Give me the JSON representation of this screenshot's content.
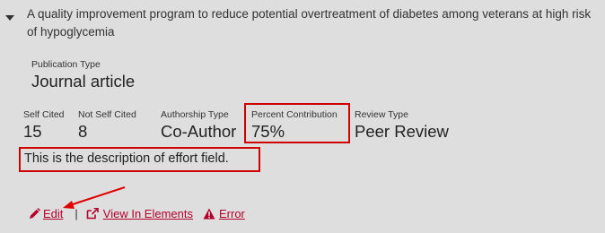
{
  "record": {
    "title": "A quality improvement program to reduce potential overtreatment of diabetes among veterans at high risk of hypoglycemia",
    "publication_type_label": "Publication Type",
    "publication_type_value": "Journal article"
  },
  "metrics": {
    "self_cited_label": "Self Cited",
    "self_cited_value": "15",
    "not_self_cited_label": "Not Self Cited",
    "not_self_cited_value": "8",
    "authorship_type_label": "Authorship Type",
    "authorship_type_value": "Co-Author",
    "percent_contribution_label": "Percent Contribution",
    "percent_contribution_value": "75%",
    "review_type_label": "Review Type",
    "review_type_value": "Peer Review"
  },
  "description": "This is the description of effort field.",
  "actions": {
    "edit_label": "Edit",
    "separator": "|",
    "view_label": "View In Elements",
    "error_label": "Error"
  },
  "colors": {
    "link": "#b3002d",
    "highlight": "#d00000",
    "background": "#dedede"
  },
  "icons": {
    "caret": "caret-down-icon",
    "edit": "pencil-icon",
    "view": "external-link-icon",
    "error": "warning-icon"
  }
}
